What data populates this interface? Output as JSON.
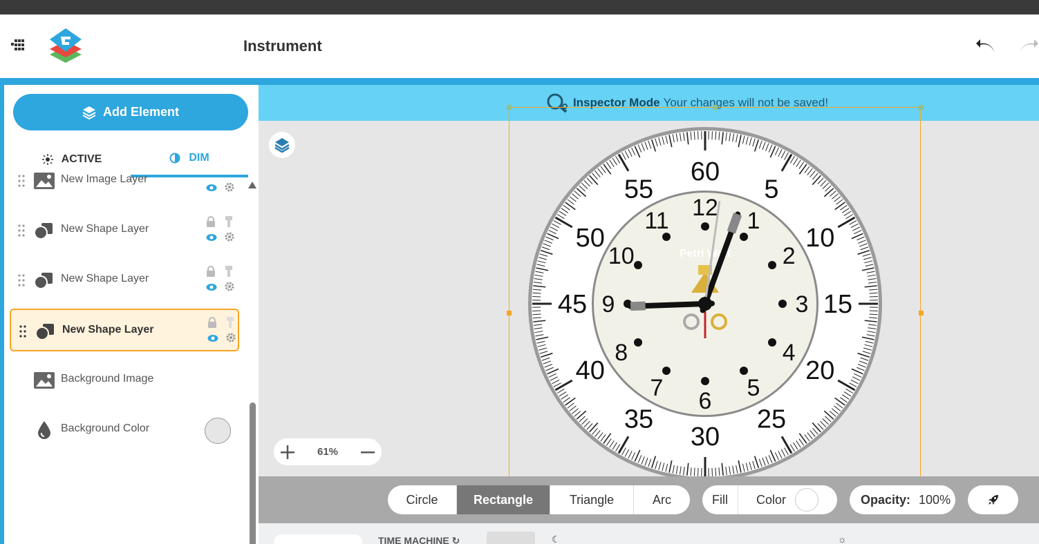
{
  "app": {
    "title": "Instrument"
  },
  "sidebar": {
    "add_button": "Add Element",
    "tabs": [
      {
        "label": "ACTIVE"
      },
      {
        "label": "DIM"
      }
    ],
    "layers": [
      {
        "name": "New Image Layer"
      },
      {
        "name": "New Shape Layer"
      },
      {
        "name": "New Shape Layer"
      },
      {
        "name": "New Shape Layer"
      },
      {
        "name": "Background Image"
      },
      {
        "name": "Background Color"
      }
    ]
  },
  "canvas": {
    "inspector_title": "Inspector Mode",
    "inspector_message": "Your changes will not be saved!",
    "zoom_level": "61%"
  },
  "clock": {
    "outer_numbers": [
      "60",
      "5",
      "10",
      "15",
      "20",
      "25",
      "30",
      "35",
      "40",
      "45",
      "50",
      "55"
    ],
    "hour_numbers": [
      "12",
      "1",
      "2",
      "3",
      "4",
      "5",
      "6",
      "7",
      "8",
      "9",
      "10",
      "11"
    ],
    "brand_text": "Petri Watt",
    "hands": {
      "hour_degrees": 268,
      "minute_degrees": 20,
      "second_degrees": 8
    }
  },
  "toolbar": {
    "shapes": [
      "Circle",
      "Rectangle",
      "Triangle",
      "Arc"
    ],
    "selected_shape": "Rectangle",
    "fill_label": "Fill",
    "color_label": "Color",
    "opacity_label": "Opacity:",
    "opacity_value": "100%"
  },
  "bottom": {
    "time_machine_label": "TIME MACHINE"
  },
  "colors": {
    "accent": "#2ea6de",
    "selection": "#f5a623",
    "inspector_bar": "#66d2f5"
  }
}
